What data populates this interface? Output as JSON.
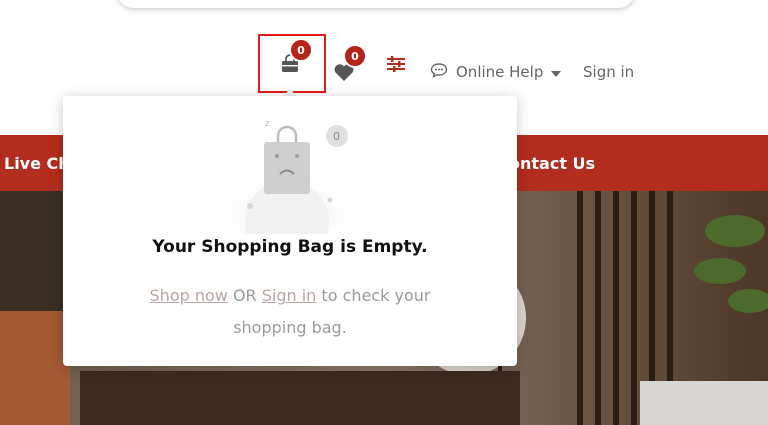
{
  "header": {
    "bag_count": "0",
    "wishlist_count": "0",
    "help_label": "Online Help",
    "signin_label": "Sign in"
  },
  "nav": {
    "left_label": "Live Cha",
    "right_label": "ontact Us"
  },
  "mini_cart": {
    "illustration_count": "0",
    "title": "Your Shopping Bag is Empty.",
    "shop_link": "Shop now",
    "or_text": " OR ",
    "signin_link": "Sign in",
    "suffix_text": " to check your shopping bag."
  },
  "colors": {
    "brand": "#b32d1e",
    "highlight_border": "#e11b1b",
    "badge": "#b3261a"
  },
  "icons": [
    "shopping-bag-icon",
    "heart-icon",
    "sliders-icon",
    "chat-bubble-icon",
    "caret-down-icon"
  ]
}
